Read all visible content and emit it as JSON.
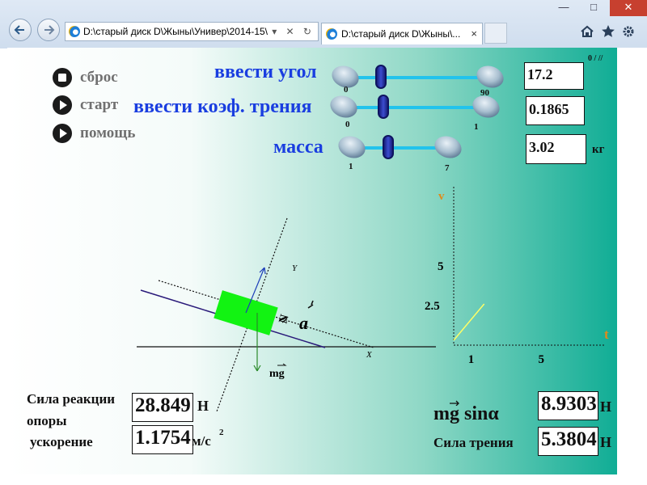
{
  "browser": {
    "address": "D:\\старый диск D\\Жыны\\Универ\\2014-15\\",
    "address_tools": "▾ ✕ ↻",
    "tab_title": "D:\\старый диск D\\Жыны\\...",
    "tab_close": "×",
    "win_min": "—",
    "win_max": "□",
    "win_close": "✕",
    "toolbar_icons": [
      "home-icon",
      "star-icon",
      "gear-icon"
    ]
  },
  "controls": {
    "reset": "сброс",
    "start": "старт",
    "help": "помощь"
  },
  "sliders": {
    "angle": {
      "label": "ввести угол",
      "min": "0",
      "max": "90",
      "value": "17.2",
      "position": 0.19
    },
    "friction": {
      "label": "ввести коэф. трения",
      "min": "0",
      "max": "1",
      "value": "0.1865",
      "position": 0.19
    },
    "mass": {
      "label": "масса",
      "min": "1",
      "max": "7",
      "value": "3.02",
      "position": 0.34,
      "unit": "кг"
    }
  },
  "angle_unit": "0 /  //",
  "diagram": {
    "y_axis": "Y",
    "x_axis": "X",
    "n_label": "N",
    "a_label": "a",
    "weight_label": "mg"
  },
  "graph": {
    "y_axis": "v",
    "x_axis": "t",
    "y_ticks": [
      "5",
      "2.5"
    ],
    "x_ticks": [
      "1",
      "5"
    ],
    "xlim": [
      0,
      6
    ],
    "ylim": [
      0,
      7
    ],
    "line": {
      "x": [
        0,
        1
      ],
      "y": [
        0,
        1.175
      ]
    },
    "line_color": "#ffff66"
  },
  "results": {
    "reaction_label_1": "Сила реакции",
    "reaction_label_2": "опоры",
    "reaction_value": "28.849",
    "reaction_unit": "Н",
    "accel_label": "ускорение",
    "accel_value": "1.1754",
    "accel_unit": "м/с",
    "accel_unit_exp": "2",
    "mgsin_label": "mg sinα",
    "mgsin_value": "8.9303",
    "mgsin_unit": "Н",
    "friction_label": "Сила трения",
    "friction_value": "5.3804",
    "friction_unit": "Н"
  },
  "colors": {
    "label_blue": "#1a3ee0",
    "block_green": "#12f312",
    "axis_orange": "#e08a1a"
  }
}
